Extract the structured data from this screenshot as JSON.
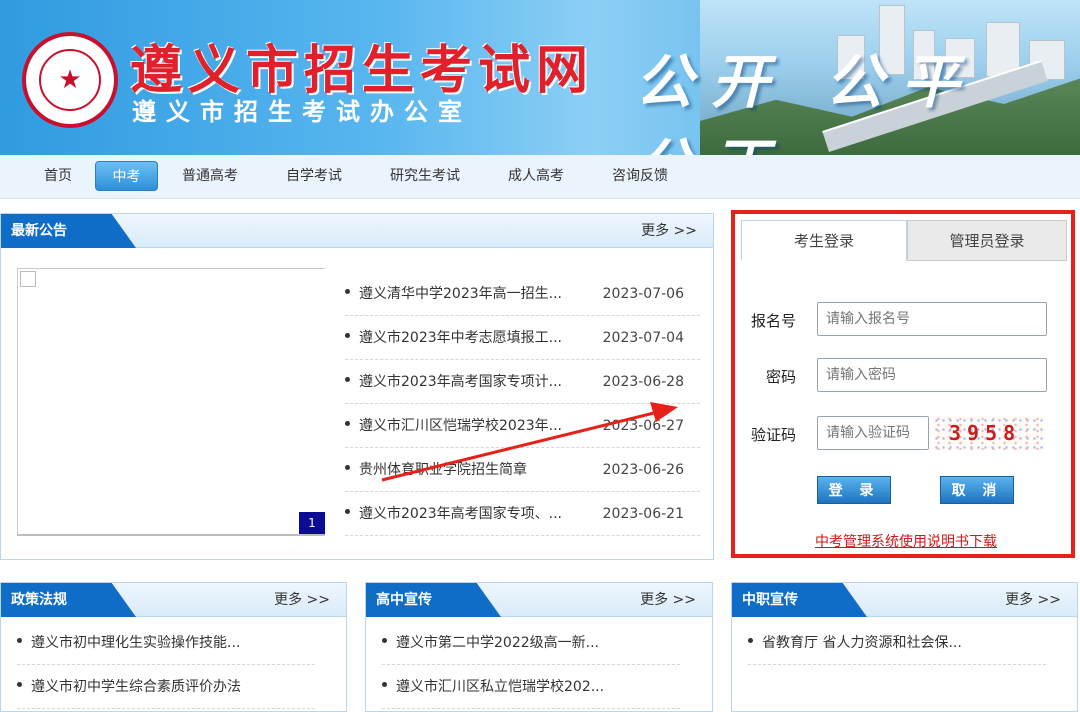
{
  "header": {
    "site_title": "遵义市招生考试网",
    "site_subtitle": "遵义市招生考试办公室",
    "slogan": "公开 公平 公正"
  },
  "nav": {
    "items": [
      {
        "label": "首页"
      },
      {
        "label": "中考",
        "active": true
      },
      {
        "label": "普通高考"
      },
      {
        "label": "自学考试"
      },
      {
        "label": "研究生考试"
      },
      {
        "label": "成人高考"
      },
      {
        "label": "咨询反馈"
      }
    ]
  },
  "announcements": {
    "heading": "最新公告",
    "more": "更多 >>",
    "pager": "1",
    "items": [
      {
        "title": "遵义清华中学2023年高一招生...",
        "date": "2023-07-06"
      },
      {
        "title": "遵义市2023年中考志愿填报工...",
        "date": "2023-07-04"
      },
      {
        "title": "遵义市2023年高考国家专项计...",
        "date": "2023-06-28"
      },
      {
        "title": "遵义市汇川区恺瑞学校2023年...",
        "date": "2023-06-27"
      },
      {
        "title": "贵州体育职业学院招生简章",
        "date": "2023-06-26"
      },
      {
        "title": "遵义市2023年高考国家专项、...",
        "date": "2023-06-21"
      }
    ]
  },
  "login": {
    "tab_student": "考生登录",
    "tab_admin": "管理员登录",
    "reg_label": "报名号",
    "reg_placeholder": "请输入报名号",
    "pwd_label": "密码",
    "pwd_placeholder": "请输入密码",
    "captcha_label": "验证码",
    "captcha_placeholder": "请输入验证码",
    "captcha_code": "3958",
    "login_btn": "登 录",
    "cancel_btn": "取 消",
    "manual_link": "中考管理系统使用说明书下载"
  },
  "policy": {
    "heading": "政策法规",
    "more": "更多 >>",
    "items": [
      "遵义市初中理化生实验操作技能...",
      "遵义市初中学生综合素质评价办法"
    ]
  },
  "highschool": {
    "heading": "高中宣传",
    "more": "更多 >>",
    "items": [
      "遵义市第二中学2022级高一新...",
      "遵义市汇川区私立恺瑞学校202..."
    ]
  },
  "vocational": {
    "heading": "中职宣传",
    "more": "更多 >>",
    "items": [
      "省教育厅 省人力资源和社会保..."
    ]
  },
  "colors": {
    "brand_blue": "#0f6cc7",
    "highlight_red": "#e8201a",
    "title_red": "#e0202a"
  }
}
